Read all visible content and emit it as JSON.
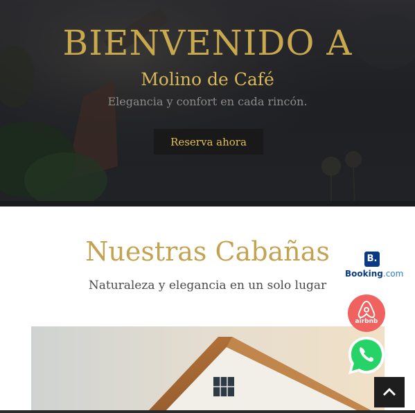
{
  "hero": {
    "title": "BIENVENIDO A",
    "subtitle": "Molino de Café",
    "tagline": "Elegancia y confort en cada rincón.",
    "cta_label": "Reserva ahora"
  },
  "section": {
    "title": "Nuestras Cabañas",
    "subtitle": "Naturaleza y elegancia en un solo lugar"
  },
  "floating": {
    "booking": {
      "letter": "B.",
      "name": "Booking",
      "suffix": ".com",
      "icon": "booking-logo"
    },
    "airbnb": {
      "label": "airbnb",
      "icon": "airbnb-logo"
    },
    "whatsapp": {
      "icon": "whatsapp-logo"
    },
    "scroll_top": {
      "icon": "chevron-up-icon"
    }
  },
  "colors": {
    "gold": "#c9a94d",
    "hero_dark": "#202226",
    "button_bg": "#191919",
    "booking_blue": "#0a3a85",
    "airbnb_red": "#f0625f",
    "whatsapp_green": "#25d366"
  }
}
